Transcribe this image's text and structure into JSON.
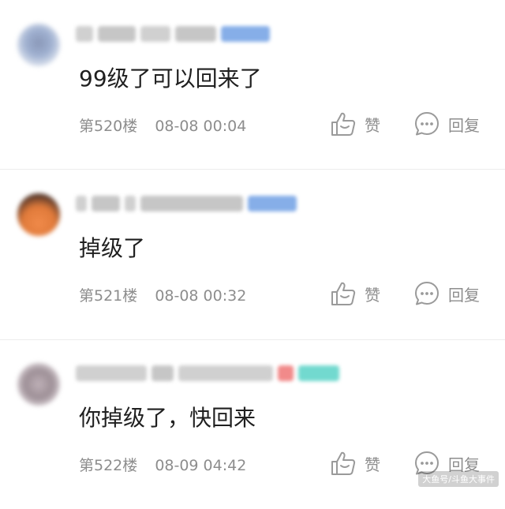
{
  "comments": [
    {
      "text": "99级了可以回来了",
      "floor": "第520楼",
      "datetime": "08-08 00:04",
      "like_label": "赞",
      "reply_label": "回复"
    },
    {
      "text": "掉级了",
      "floor": "第521楼",
      "datetime": "08-08 00:32",
      "like_label": "赞",
      "reply_label": "回复"
    },
    {
      "text": "你掉级了，快回来",
      "floor": "第522楼",
      "datetime": "08-09 04:42",
      "like_label": "赞",
      "reply_label": "回复"
    }
  ],
  "icons": {
    "like": "thumbs-up-icon",
    "reply": "chat-bubble-icon"
  },
  "colors": {
    "meta_text": "#8d8d8d",
    "body_text": "#1f1f1f",
    "divider": "#ececec"
  },
  "watermark": "大鱼号/斗鱼大事件"
}
